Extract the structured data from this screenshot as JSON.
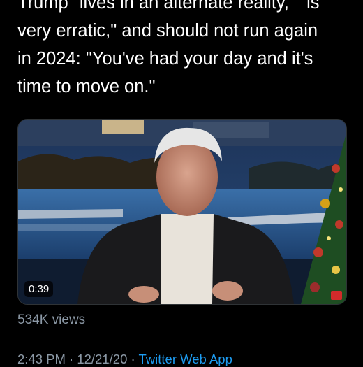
{
  "tweet": {
    "text_lines": [
      "Trump \"lives in an alternate reality,\" \"is",
      "very erratic,\" and should not run again",
      "in 2024: \"You've had your day and it's",
      "time to move on.\""
    ]
  },
  "video": {
    "duration": "0:39"
  },
  "stats": {
    "views": "534K views"
  },
  "meta": {
    "time": "2:43 PM",
    "separator": "·",
    "date": "12/21/20",
    "source": "Twitter Web App"
  },
  "colors": {
    "background": "#000000",
    "text": "#ffffff",
    "secondary_text": "#8b98a5",
    "link": "#1d9bf0"
  }
}
